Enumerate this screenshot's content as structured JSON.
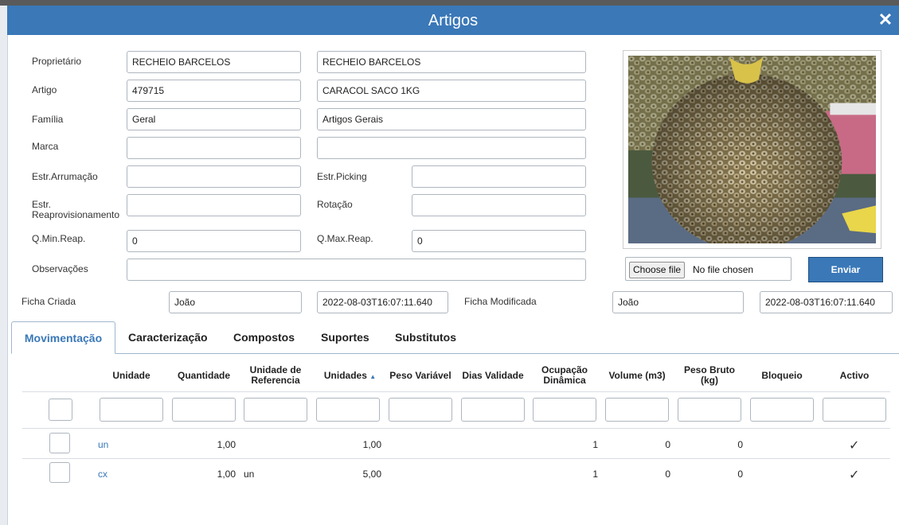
{
  "window": {
    "title": "Artigos"
  },
  "form": {
    "proprietario": {
      "label": "Proprietário",
      "code": "RECHEIO BARCELOS",
      "name": "RECHEIO BARCELOS"
    },
    "artigo": {
      "label": "Artigo",
      "code": "479715",
      "name": "CARACOL SACO 1KG"
    },
    "familia": {
      "label": "Família",
      "code": "Geral",
      "name": "Artigos Gerais"
    },
    "marca": {
      "label": "Marca",
      "code": "",
      "name": ""
    },
    "estr_arrumacao": {
      "label": "Estr.Arrumação",
      "value": ""
    },
    "estr_picking": {
      "label": "Estr.Picking",
      "value": ""
    },
    "estr_reaprov": {
      "label_line1": "Estr.",
      "label_line2": "Reaprovisionamento",
      "value": ""
    },
    "rotacao": {
      "label": "Rotação",
      "value": ""
    },
    "qmin": {
      "label": "Q.Min.Reap.",
      "value": "0"
    },
    "qmax": {
      "label": "Q.Max.Reap.",
      "value": "0"
    },
    "observacoes": {
      "label": "Observações",
      "value": ""
    },
    "ficha_criada": {
      "label": "Ficha Criada",
      "user": "João",
      "date": "2022-08-03T16:07:11.640"
    },
    "ficha_modificada": {
      "label": "Ficha Modificada",
      "user": "João",
      "date": "2022-08-03T16:07:11.640"
    }
  },
  "upload": {
    "choose_label": "Choose file",
    "status": "No file chosen",
    "send_label": "Enviar"
  },
  "tabs": [
    "Movimentação",
    "Caracterização",
    "Compostos",
    "Suportes",
    "Substitutos"
  ],
  "table": {
    "headers": {
      "unidade": "Unidade",
      "quantidade": "Quantidade",
      "unidade_ref_1": "Unidade de",
      "unidade_ref_2": "Referencia",
      "unidades": "Unidades",
      "peso_variavel": "Peso Variável",
      "dias_validade": "Dias Validade",
      "ocupacao_1": "Ocupação",
      "ocupacao_2": "Dinâmica",
      "volume": "Volume (m3)",
      "peso_bruto_1": "Peso Bruto",
      "peso_bruto_2": "(kg)",
      "bloqueio": "Bloqueio",
      "activo": "Activo"
    },
    "sort_indicator": "▲",
    "rows": [
      {
        "unidade": "un",
        "quantidade": "1,00",
        "unidade_ref": "",
        "unidades": "1,00",
        "ocupacao": "1",
        "volume": "0",
        "peso_bruto": "0",
        "activo": "✓"
      },
      {
        "unidade": "cx",
        "quantidade": "1,00",
        "unidade_ref": "un",
        "unidades": "5,00",
        "ocupacao": "1",
        "volume": "0",
        "peso_bruto": "0",
        "activo": "✓"
      }
    ]
  },
  "icons": {
    "close": "close-icon",
    "photo": "product-photo"
  }
}
